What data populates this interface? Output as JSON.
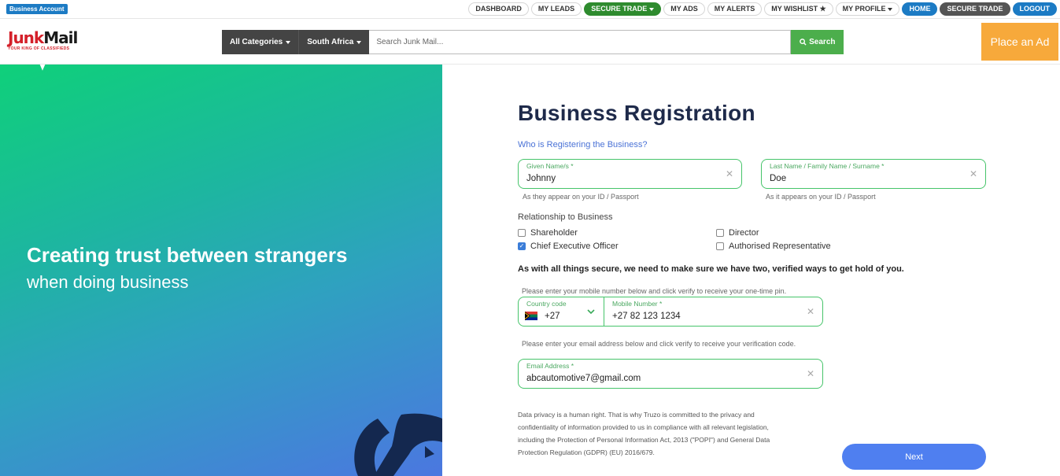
{
  "topbar": {
    "business_badge": "Business Account",
    "nav": [
      {
        "label": "DASHBOARD",
        "style": "plain"
      },
      {
        "label": "MY LEADS",
        "style": "plain"
      },
      {
        "label": "SECURE TRADE",
        "style": "green",
        "caret": true
      },
      {
        "label": "MY ADS",
        "style": "plain"
      },
      {
        "label": "MY ALERTS",
        "style": "plain"
      },
      {
        "label": "MY WISHLIST ★",
        "style": "plain"
      },
      {
        "label": "MY PROFILE",
        "style": "plain",
        "caret": true
      },
      {
        "label": "HOME",
        "style": "blue"
      },
      {
        "label": "SECURE TRADE",
        "style": "gray"
      },
      {
        "label": "LOGOUT",
        "style": "blue"
      }
    ]
  },
  "header": {
    "logo_part1": "Junk",
    "logo_part2": "Mail",
    "logo_tagline": "YOUR KING OF CLASSIFIEDS",
    "category_dropdown": "All Categories",
    "region_dropdown": "South Africa",
    "search_placeholder": "Search Junk Mail...",
    "search_button": "Search",
    "place_ad": "Place an Ad"
  },
  "hero": {
    "headline": "Creating trust between strangers",
    "subline": "when doing business"
  },
  "form": {
    "title": "Business Registration",
    "subtitle": "Who is Registering the Business?",
    "given_name": {
      "label": "Given Name/s *",
      "value": "Johnny",
      "hint": "As they appear on your ID / Passport"
    },
    "last_name": {
      "label": "Last Name / Family Name / Surname *",
      "value": "Doe",
      "hint": "As it appears on your ID / Passport"
    },
    "relationship_label": "Relationship to Business",
    "relationships": [
      {
        "label": "Shareholder",
        "checked": false
      },
      {
        "label": "Director",
        "checked": false
      },
      {
        "label": "Chief Executive Officer",
        "checked": true
      },
      {
        "label": "Authorised Representative",
        "checked": false
      }
    ],
    "security_notice": "As with all things secure, we need to make sure we have two, verified ways to get hold of you.",
    "mobile_hint": "Please enter your mobile number below and click verify to receive your one-time pin.",
    "country_code": {
      "label": "Country code",
      "value": "+27"
    },
    "mobile": {
      "label": "Mobile Number *",
      "value": "+27 82 123 1234"
    },
    "email_hint": "Please enter your email address below and click verify to receive your verification code.",
    "email": {
      "label": "Email Address *",
      "value": "abcautomotive7@gmail.com"
    },
    "privacy_text": "Data privacy is a human right. That is why Truzo is committed to the privacy and confidentiality of information provided to us in compliance with all relevant legislation, including the Protection of Personal Information Act, 2013 (\"POPI\") and General Data Protection Regulation (GDPR) (EU) 2016/679.",
    "next_button": "Next"
  },
  "colors": {
    "accent_green": "#46c46a",
    "accent_blue": "#4f7ff0",
    "place_ad_orange": "#f7a93b",
    "title_navy": "#1e2a4a"
  }
}
